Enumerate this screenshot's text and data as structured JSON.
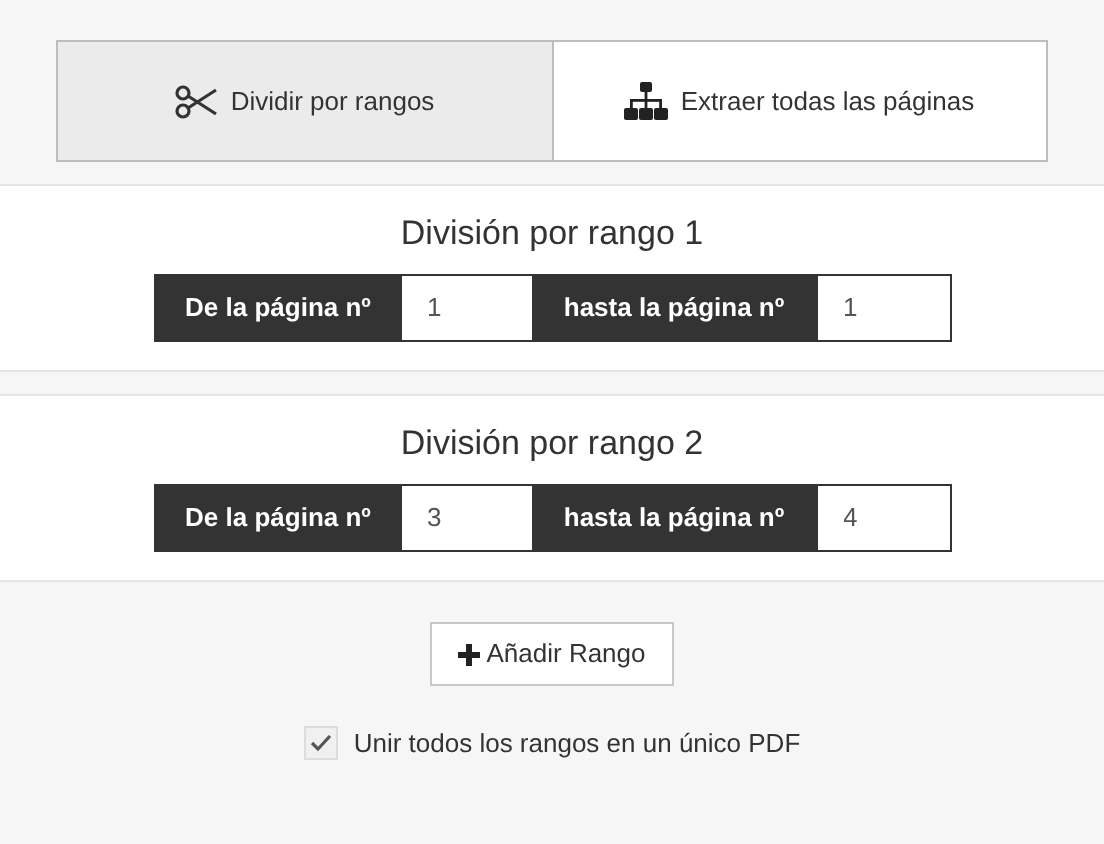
{
  "tabs": [
    {
      "label": "Dividir por rangos",
      "kind": "scissors",
      "selected": true
    },
    {
      "label": "Extraer todas las páginas",
      "kind": "sitemap",
      "selected": false
    }
  ],
  "ranges": [
    {
      "title": "División por rango 1",
      "from_label": "De la página nº",
      "from": "1",
      "to_label": "hasta la página nº",
      "to": "1"
    },
    {
      "title": "División por rango 2",
      "from_label": "De la página nº",
      "from": "3",
      "to_label": "hasta la página nº",
      "to": "4"
    }
  ],
  "add_button": "Añadir Rango",
  "merge": {
    "label": "Unir todos los rangos en un único PDF",
    "checked": true
  }
}
